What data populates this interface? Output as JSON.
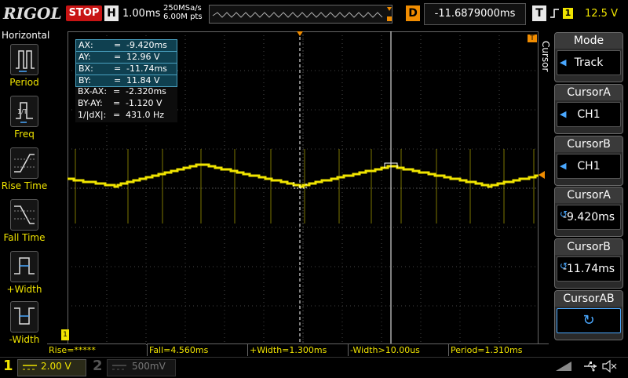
{
  "header": {
    "brand": "RIGOL",
    "run_state": "STOP",
    "horizontal_label": "H",
    "timebase": "1.00ms",
    "sample_rate": "250MSa/s",
    "memory_depth": "6.00M pts",
    "delay_label": "D",
    "delay_value": "-11.6879000ms",
    "trigger_label": "T",
    "trigger_source": "1",
    "trigger_level": "12.5 V"
  },
  "left_menu": {
    "title": "Horizontal",
    "items": [
      {
        "label": "Period",
        "icon": "period-icon"
      },
      {
        "label": "Freq",
        "icon": "freq-icon"
      },
      {
        "label": "Rise Time",
        "icon": "rise-time-icon"
      },
      {
        "label": "Fall Time",
        "icon": "fall-time-icon"
      },
      {
        "label": "+Width",
        "icon": "plus-width-icon"
      },
      {
        "label": "-Width",
        "icon": "minus-width-icon"
      }
    ]
  },
  "cursor_readout": {
    "rows": [
      {
        "key": "AX:",
        "eq": "=",
        "value": "-9.420ms"
      },
      {
        "key": "AY:",
        "eq": "=",
        "value": "12.96 V"
      },
      {
        "key": "BX:",
        "eq": "=",
        "value": "-11.74ms"
      },
      {
        "key": "BY:",
        "eq": "=",
        "value": "11.84 V"
      },
      {
        "key": "BX-AX:",
        "eq": "=",
        "value": "-2.320ms"
      },
      {
        "key": "BY-AY:",
        "eq": "=",
        "value": "-1.120 V"
      },
      {
        "key": "1/|dX|:",
        "eq": "=",
        "value": "431.0 Hz"
      }
    ]
  },
  "measurements": [
    "Rise=*****",
    "Fall=4.560ms",
    "+Width=1.300ms",
    "-Width>10.00us",
    "Period=1.310ms"
  ],
  "channels": {
    "ch1": {
      "number": "1",
      "scale": "2.00 V"
    },
    "ch2": {
      "number": "2",
      "scale": "500mV"
    }
  },
  "right_menu": {
    "side_title": "Cursor",
    "mode": {
      "label": "Mode",
      "value": "Track"
    },
    "cursor_a_src": {
      "label": "CursorA",
      "value": "CH1"
    },
    "cursor_b_src": {
      "label": "CursorB",
      "value": "CH1"
    },
    "cursor_a_pos": {
      "label": "CursorA",
      "value": "-9.420ms"
    },
    "cursor_b_pos": {
      "label": "CursorB",
      "value": "-11.74ms"
    },
    "cursor_ab": {
      "label": "CursorAB"
    }
  },
  "markers": {
    "trigger_marker": "T",
    "channel_marker": "1"
  },
  "colors": {
    "ch1": "#f0e400",
    "accent_blue": "#4aa8ff",
    "stop_red": "#c81414",
    "delay_orange": "#f08c00"
  }
}
